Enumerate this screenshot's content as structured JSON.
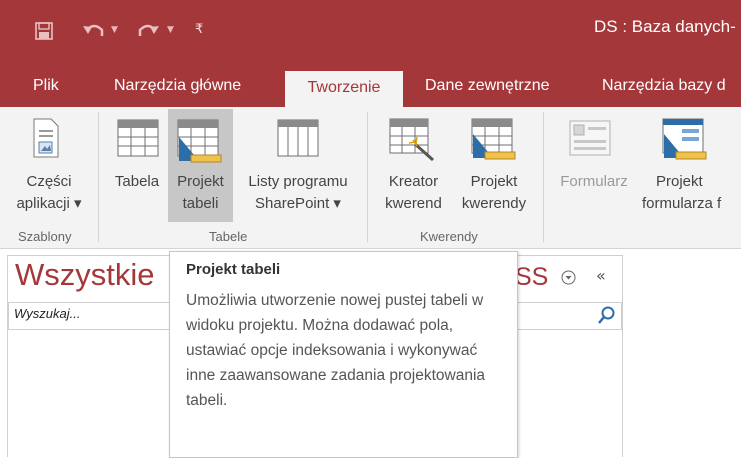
{
  "title_bar": {
    "document_title": "DS : Baza danych-",
    "quick_access": [
      "save-icon",
      "undo-icon",
      "redo-icon",
      "customize-qat-icon"
    ]
  },
  "tabs": [
    {
      "label": "Plik"
    },
    {
      "label": "Narzędzia główne"
    },
    {
      "label": "Tworzenie",
      "active": true
    },
    {
      "label": "Dane zewnętrzne"
    },
    {
      "label": "Narzędzia bazy d"
    }
  ],
  "ribbon": {
    "groups": [
      {
        "label": "Szablony",
        "commands": [
          {
            "line1": "Części",
            "line2": "aplikacji ▾",
            "icon": "app-parts-icon"
          }
        ]
      },
      {
        "label": "Tabele",
        "commands": [
          {
            "line1": "Tabela",
            "line2": "",
            "icon": "table-icon"
          },
          {
            "line1": "Projekt",
            "line2": "tabeli",
            "icon": "table-design-icon",
            "hovered": true
          },
          {
            "line1": "Listy programu",
            "line2": "SharePoint ▾",
            "icon": "sharepoint-lists-icon"
          }
        ]
      },
      {
        "label": "Kwerendy",
        "commands": [
          {
            "line1": "Kreator",
            "line2": "kwerend",
            "icon": "query-wizard-icon"
          },
          {
            "line1": "Projekt",
            "line2": "kwerendy",
            "icon": "query-design-icon"
          }
        ]
      },
      {
        "label": "",
        "commands": [
          {
            "line1": "Formularz",
            "line2": "",
            "icon": "form-icon",
            "disabled": true
          },
          {
            "line1": "Projekt",
            "line2": "formularza f",
            "icon": "form-design-icon"
          }
        ]
      }
    ]
  },
  "nav_pane": {
    "title": "Wszystkie",
    "title_tail": "SS",
    "search_placeholder": "Wyszukaj..."
  },
  "tooltip": {
    "title": "Projekt tabeli",
    "body": "Umożliwia utworzenie nowej pustej tabeli w widoku projektu. Można dodawać pola, ustawiać opcje indeksowania i wykonywać inne zaawansowane zadania projektowania tabeli."
  },
  "colors": {
    "accent": "#a4373a",
    "ribbon_bg": "#f3f3f3",
    "hover": "#c7c7c7"
  }
}
